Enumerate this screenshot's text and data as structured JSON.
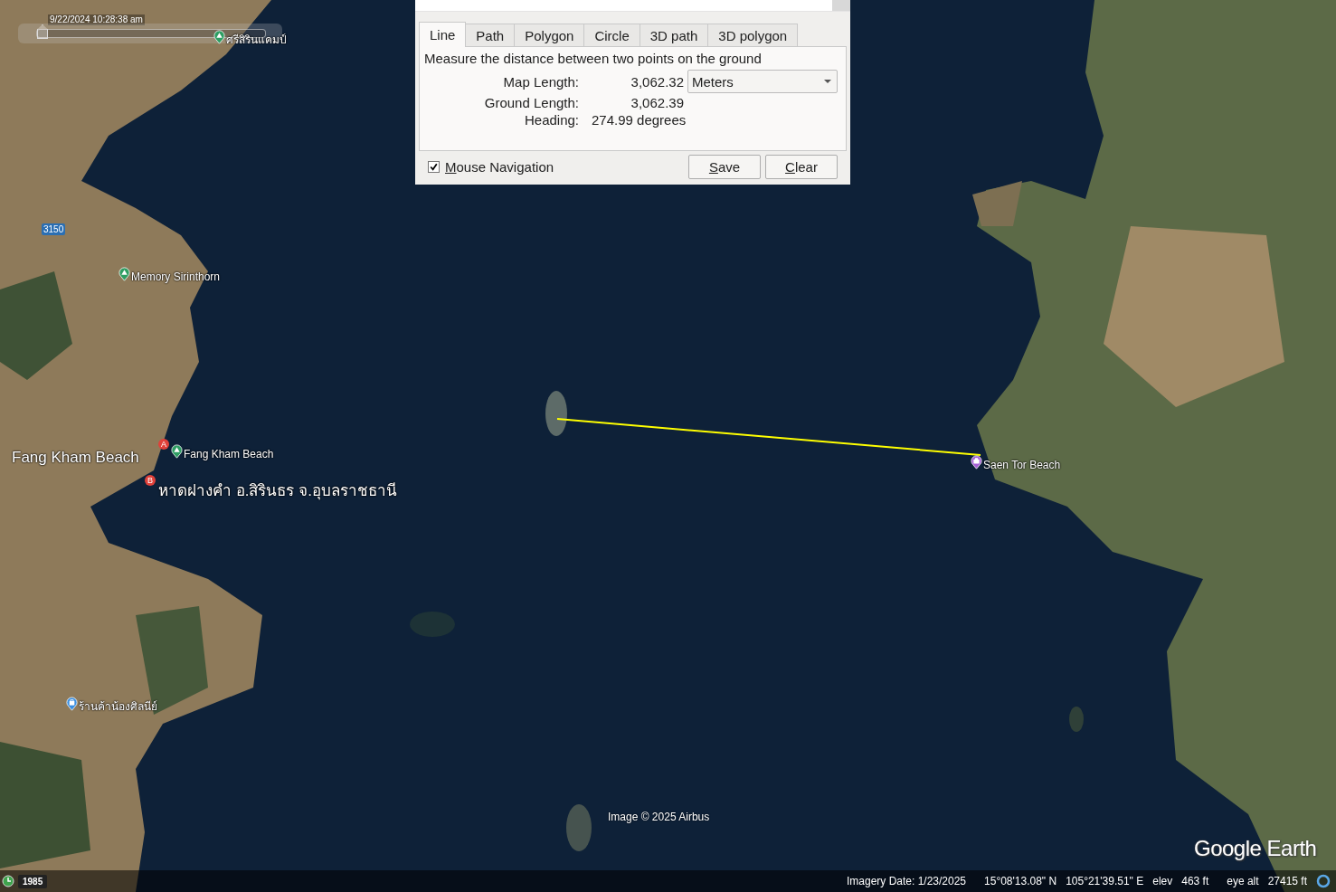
{
  "timeline": {
    "timestamp": "9/22/2024  10:28:38 am",
    "level": 0
  },
  "map": {
    "road_sign": "3150",
    "placemarks": [
      {
        "kind": "park",
        "label": "ศรีสิรินแคมป์"
      },
      {
        "kind": "park",
        "label": "Memory Sirinthorn"
      },
      {
        "kind": "title",
        "label": "Fang Kham Beach"
      },
      {
        "kind": "lettered",
        "letter": "A"
      },
      {
        "kind": "park",
        "label": "Fang Kham Beach"
      },
      {
        "kind": "lettered",
        "letter": "B",
        "label": "หาดฝางคำ อ.สิรินธร จ.อุบลราชธานี"
      },
      {
        "kind": "camera",
        "label": "Saen Tor Beach"
      },
      {
        "kind": "shop",
        "label": "ร้านค้าน้องศิลนีย์"
      }
    ],
    "attribution": "Image © 2025 Airbus",
    "logo": "Google Earth"
  },
  "ruler_dialog": {
    "tabs": [
      {
        "label": "Line",
        "selected": true
      },
      {
        "label": "Path",
        "selected": false
      },
      {
        "label": "Polygon",
        "selected": false
      },
      {
        "label": "Circle",
        "selected": false
      },
      {
        "label": "3D path",
        "selected": false
      },
      {
        "label": "3D polygon",
        "selected": false
      }
    ],
    "description": "Measure the distance between two points on the ground",
    "rows": [
      {
        "label": "Map Length:",
        "value": "3,062.32"
      },
      {
        "label": "Ground Length:",
        "value": "3,062.39"
      },
      {
        "label": "Heading:",
        "value": "274.99 degrees"
      }
    ],
    "unit": "Meters",
    "mouse_navigation": {
      "label": "Mouse Navigation",
      "checked": true
    },
    "buttons": [
      "Save",
      "Clear"
    ]
  },
  "status_bar": {
    "year": "1985",
    "imagery_date": "Imagery Date: 1/23/2025",
    "latitude": "15°08'13.08\" N",
    "longitude": "105°21'39.51\" E",
    "elev_label": "elev",
    "elev": "463 ft",
    "eye_alt_label": "eye alt",
    "eye_alt": "27415 ft"
  }
}
